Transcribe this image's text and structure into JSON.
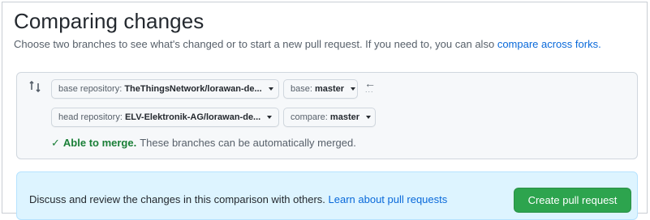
{
  "page": {
    "title": "Comparing changes",
    "subtitle_text": "Choose two branches to see what's changed or to start a new pull request. If you need to, you can also",
    "subtitle_link": "compare across forks."
  },
  "compare": {
    "base_repo_label": "base repository:",
    "base_repo_value": "TheThingsNetwork/lorawan-de...",
    "base_label": "base:",
    "base_value": "master",
    "swap_arrow": "←",
    "swap_dots": "...",
    "head_repo_label": "head repository:",
    "head_repo_value": "ELV-Elektronik-AG/lorawan-de...",
    "compare_label": "compare:",
    "compare_value": "master",
    "merge_check": "✓",
    "merge_status": "Able to merge.",
    "merge_detail": "These branches can be automatically merged."
  },
  "pull_request": {
    "text": "Discuss and review the changes in this comparison with others.",
    "link": "Learn about pull requests",
    "button": "Create pull request"
  },
  "colors": {
    "link": "#0969da",
    "success": "#1a7f37",
    "button_green": "#2da44e",
    "info_bg": "#ddf4ff"
  }
}
